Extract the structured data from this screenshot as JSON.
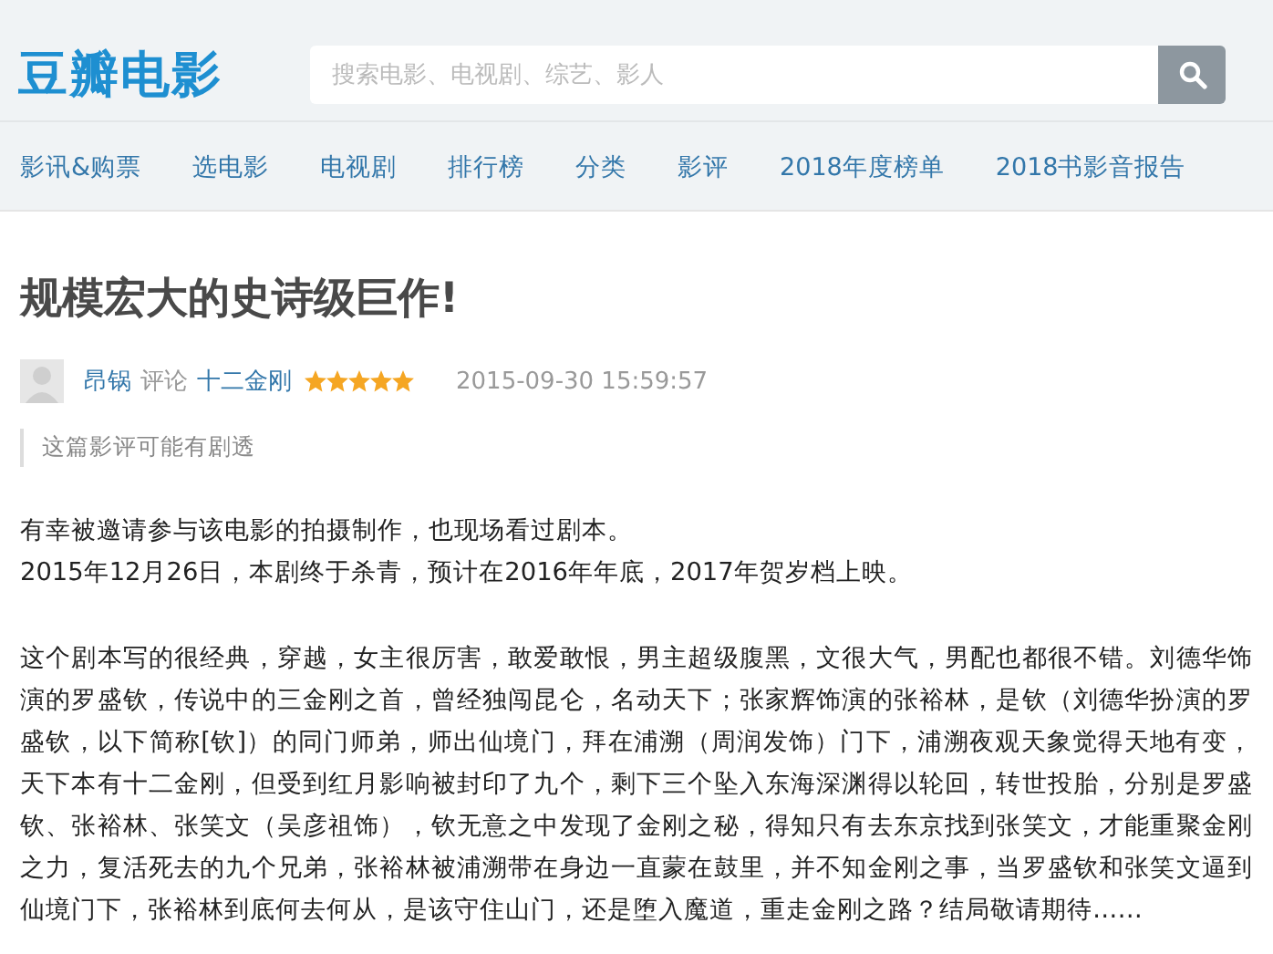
{
  "header": {
    "logo": "豆瓣电影",
    "search": {
      "placeholder": "搜索电影、电视剧、综艺、影人"
    }
  },
  "nav": [
    "影讯&购票",
    "选电影",
    "电视剧",
    "排行榜",
    "分类",
    "影评",
    "2018年度榜单",
    "2018书影音报告"
  ],
  "review": {
    "title": "规模宏大的史诗级巨作!",
    "author": "昂锅",
    "action": "评论",
    "movie": "十二金刚",
    "stars": 5,
    "date": "2015-09-30 15:59:57",
    "spoiler_note": "这篇影评可能有剧透",
    "paragraphs": [
      "有幸被邀请参与该电影的拍摄制作，也现场看过剧本。\n2015年12月26日，本剧终于杀青，预计在2016年年底，2017年贺岁档上映。",
      "这个剧本写的很经典，穿越，女主很厉害，敢爱敢恨，男主超级腹黑，文很大气，男配也都很不错。刘德华饰演的罗盛钦，传说中的三金刚之首，曾经独闯昆仑，名动天下；张家辉饰演的张裕林，是钦（刘德华扮演的罗盛钦，以下简称[钦]）的同门师弟，师出仙境门，拜在浦溯（周润发饰）门下，浦溯夜观天象觉得天地有变，天下本有十二金刚，但受到红月影响被封印了九个，剩下三个坠入东海深渊得以轮回，转世投胎，分别是罗盛钦、张裕林、张笑文（吴彦祖饰），钦无意之中发现了金刚之秘，得知只有去东京找到张笑文，才能重聚金刚之力，复活死去的九个兄弟，张裕林被浦溯带在身边一直蒙在鼓里，并不知金刚之事，当罗盛钦和张笑文逼到仙境门下，张裕林到底何去何从，是该守住山门，还是堕入魔道，重走金刚之路？结局敬请期待……"
    ]
  }
}
